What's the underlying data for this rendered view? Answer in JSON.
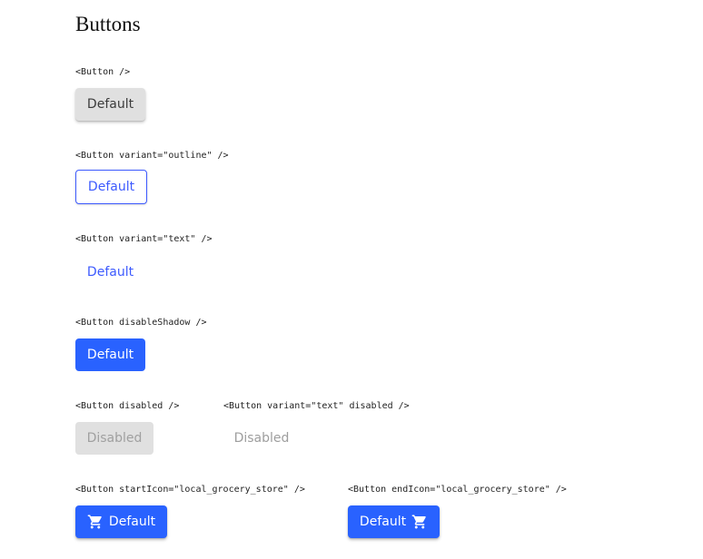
{
  "page": {
    "title": "Buttons"
  },
  "sections": {
    "default": {
      "code": "<Button />",
      "button_label": "Default"
    },
    "outline": {
      "code": "<Button variant=\"outline\" />",
      "button_label": "Default"
    },
    "text": {
      "code": "<Button variant=\"text\" />",
      "button_label": "Default"
    },
    "disable_shadow": {
      "code": "<Button disableShadow />",
      "button_label": "Default"
    },
    "disabled": {
      "code": "<Button disabled />",
      "button_label": "Disabled"
    },
    "text_disabled": {
      "code": "<Button variant=\"text\" disabled />",
      "button_label": "Disabled"
    },
    "start_icon": {
      "code": "<Button startIcon=\"local_grocery_store\" />",
      "button_label": "Default",
      "icon": "shopping-cart-icon"
    },
    "end_icon": {
      "code": "<Button endIcon=\"local_grocery_store\" />",
      "button_label": "Default",
      "icon": "shopping-cart-icon"
    }
  },
  "colors": {
    "primary": "#2962ff",
    "outline_accent": "#3d5afe",
    "default_bg": "#e0e0e0",
    "disabled_text": "#a0a0a0"
  }
}
